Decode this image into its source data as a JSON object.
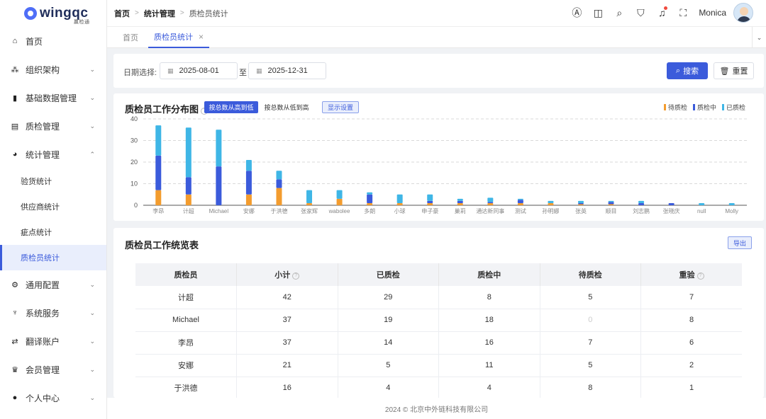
{
  "app": {
    "name": "wingqc",
    "sub": "赢检通"
  },
  "sidebar": {
    "items": [
      {
        "label": "首页",
        "icon": "home-icon",
        "glyph": "⌂",
        "chevron": ""
      },
      {
        "label": "组织架构",
        "icon": "org-icon",
        "glyph": "⁂",
        "chevron": "⌄"
      },
      {
        "label": "基础数据管理",
        "icon": "bar-chart-icon",
        "glyph": "▮",
        "chevron": "⌄"
      },
      {
        "label": "质检管理",
        "icon": "inspect-icon",
        "glyph": "▤",
        "chevron": "⌄"
      },
      {
        "label": "统计管理",
        "icon": "pie-chart-icon",
        "glyph": "◕",
        "chevron": "⌃"
      }
    ],
    "sub_items": [
      {
        "label": "验货统计"
      },
      {
        "label": "供应商统计"
      },
      {
        "label": "疵点统计"
      },
      {
        "label": "质检员统计"
      }
    ],
    "items_after": [
      {
        "label": "通用配置",
        "icon": "gear-icon",
        "glyph": "⚙",
        "chevron": "⌄"
      },
      {
        "label": "系统服务",
        "icon": "service-icon",
        "glyph": "♆",
        "chevron": "⌄"
      },
      {
        "label": "翻译账户",
        "icon": "translate-icon",
        "glyph": "⇄",
        "chevron": "⌄"
      },
      {
        "label": "会员管理",
        "icon": "crown-icon",
        "glyph": "♛",
        "chevron": "⌄"
      },
      {
        "label": "个人中心",
        "icon": "user-icon",
        "glyph": "●",
        "chevron": "⌄"
      }
    ]
  },
  "header": {
    "breadcrumb": [
      "首页",
      "统计管理",
      "质检员统计"
    ],
    "username": "Monica",
    "icons": [
      "ai-icon",
      "layout-icon",
      "search-icon",
      "shirt-icon",
      "bell-icon",
      "fullscreen-icon"
    ]
  },
  "tabs": {
    "home": "首页",
    "active": "质检员统计",
    "close": "×"
  },
  "search": {
    "date_label": "日期选择:",
    "start_date": "2025-08-01",
    "to_label": "至",
    "end_date": "2025-12-31",
    "search_label": "搜索",
    "reset_label": "重置"
  },
  "chart_card": {
    "title": "质检员工作分布图",
    "sort_desc": "按总数从高到低",
    "sort_asc": "按总数从低到高",
    "display_settings": "显示设置",
    "legend": [
      {
        "label": "待质检",
        "color": "#f39c2e"
      },
      {
        "label": "质检中",
        "color": "#3b5bdb"
      },
      {
        "label": "已质检",
        "color": "#3fb6e6"
      }
    ]
  },
  "chart_data": {
    "type": "bar",
    "stacked": true,
    "ylim": [
      0,
      40
    ],
    "yticks": [
      0,
      10,
      20,
      30,
      40
    ],
    "categories": [
      "李昂",
      "计超",
      "Michael",
      "安娜",
      "于洪德",
      "张家辉",
      "wabolee",
      "多朗",
      "小球",
      "申子豪",
      "巢莉",
      "通达新同事",
      "测试",
      "孙明娜",
      "张英",
      "顺目",
      "刘志鹏",
      "张晓庆",
      "null",
      "Molly"
    ],
    "series": [
      {
        "name": "待质检",
        "color": "#f39c2e",
        "values": [
          7,
          5,
          0,
          5,
          8,
          1,
          3,
          1,
          1,
          1,
          1,
          1,
          1,
          1,
          0.5,
          0.5,
          0,
          0,
          0,
          0
        ]
      },
      {
        "name": "质检中",
        "color": "#3b5bdb",
        "values": [
          16,
          8,
          18,
          11,
          4,
          0,
          0,
          4,
          0,
          1,
          1,
          0.5,
          1.5,
          0,
          0.5,
          1,
          1,
          1,
          0,
          0
        ]
      },
      {
        "name": "已质检",
        "color": "#3fb6e6",
        "values": [
          14,
          23,
          17,
          5,
          4,
          6,
          4,
          1,
          4,
          3,
          1,
          2,
          0.5,
          1,
          1,
          0.5,
          1,
          0,
          1,
          1
        ]
      }
    ]
  },
  "table_card": {
    "title": "质检员工作统览表",
    "export_label": "导出",
    "columns": [
      {
        "label": "质检员",
        "help": false
      },
      {
        "label": "小计",
        "help": true
      },
      {
        "label": "已质检",
        "help": false
      },
      {
        "label": "质检中",
        "help": false
      },
      {
        "label": "待质检",
        "help": false
      },
      {
        "label": "重验",
        "help": true
      }
    ],
    "rows": [
      [
        "计超",
        "42",
        "29",
        "8",
        "5",
        "7"
      ],
      [
        "Michael",
        "37",
        "19",
        "18",
        "0",
        "8"
      ],
      [
        "李昂",
        "37",
        "14",
        "16",
        "7",
        "6"
      ],
      [
        "安娜",
        "21",
        "5",
        "11",
        "5",
        "2"
      ],
      [
        "于洪德",
        "16",
        "4",
        "4",
        "8",
        "1"
      ]
    ]
  },
  "footer": {
    "text": "2024 © 北京中外链科技有限公司"
  }
}
